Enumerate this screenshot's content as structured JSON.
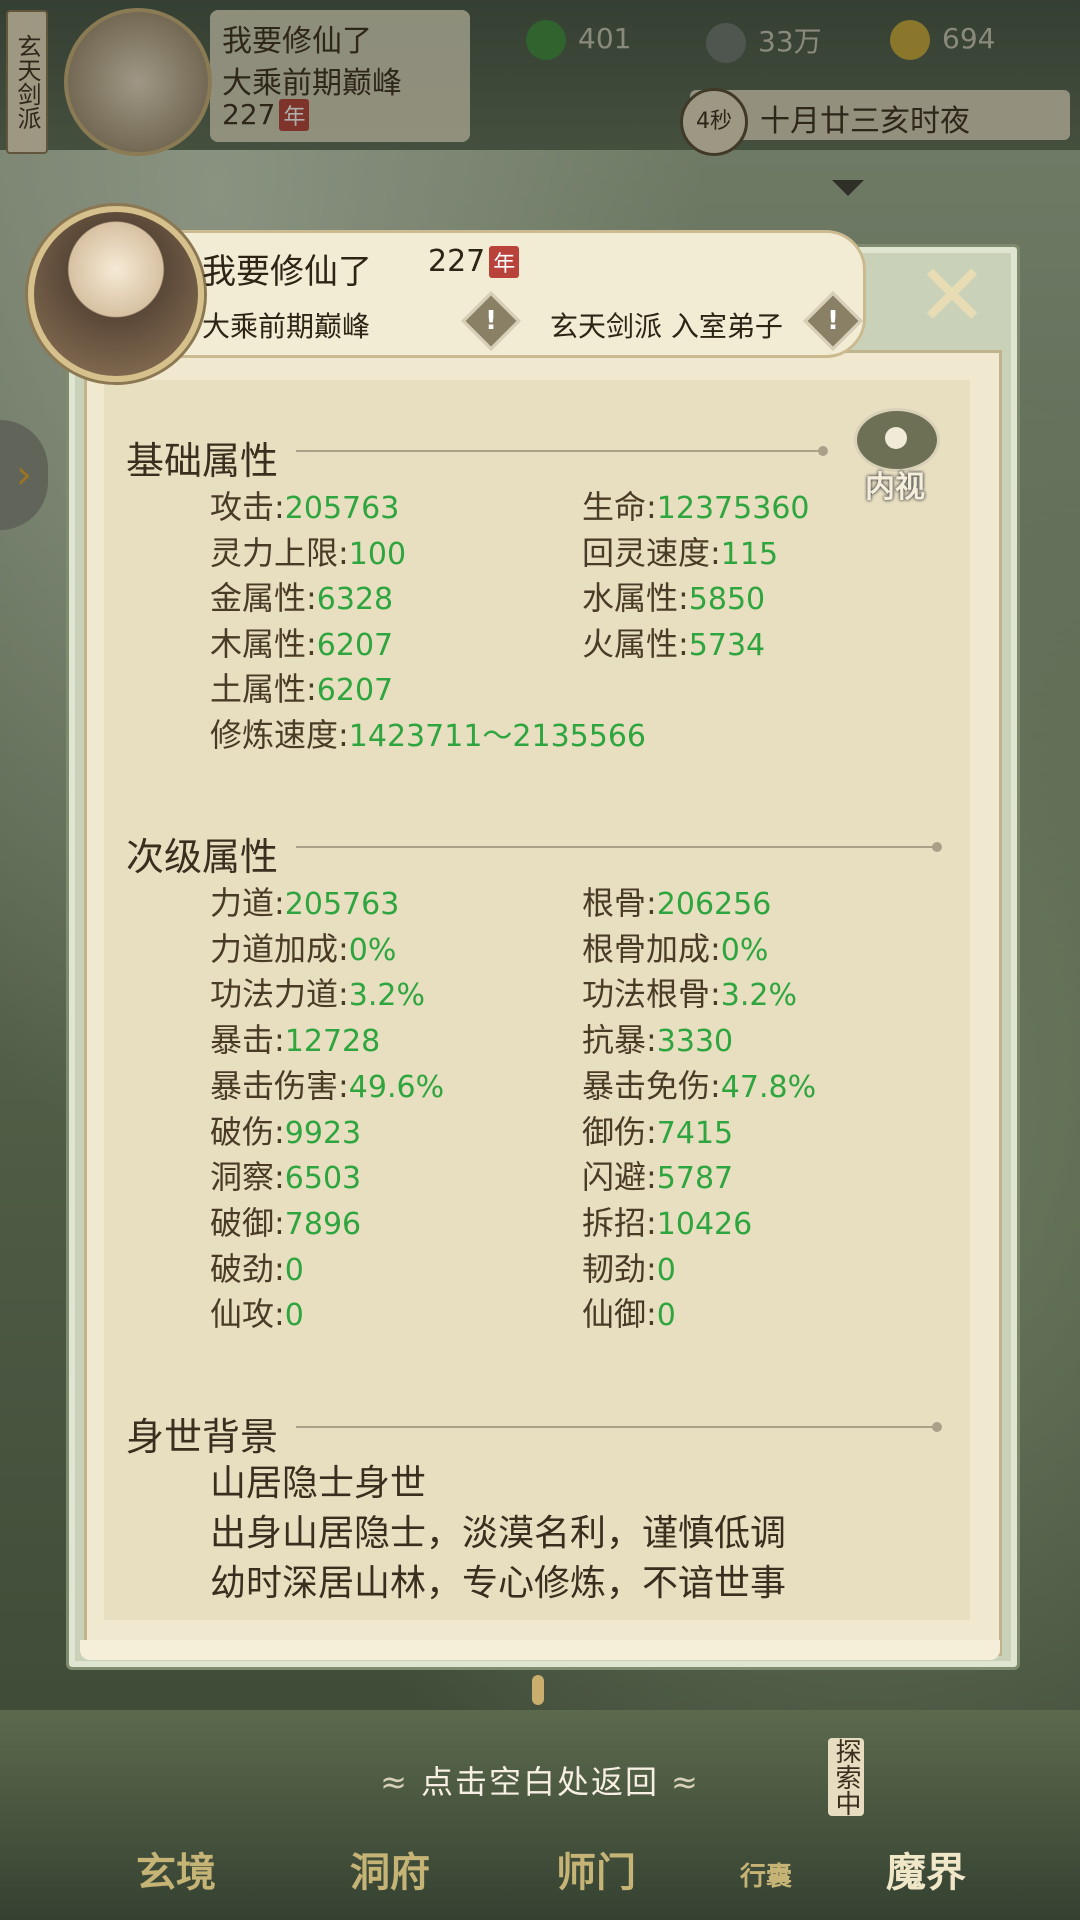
{
  "hud": {
    "sect_banner": "玄天剑派",
    "player_name": "我要修仙了",
    "realm": "大乘前期巅峰",
    "age": "227",
    "year_tag": "年",
    "resources": [
      {
        "icon": "leaf-icon",
        "value": "401"
      },
      {
        "icon": "coin-icon",
        "value": "33万"
      },
      {
        "icon": "ingot-icon",
        "value": "694"
      }
    ],
    "timer": "4秒",
    "date": "十月廿三亥时夜"
  },
  "panel": {
    "name": "我要修仙了",
    "age": "227",
    "year_tag": "年",
    "realm": "大乘前期巅峰",
    "sect": "玄天剑派 入室弟子",
    "inner_view_label": "内视",
    "basic_title": "基础属性",
    "basic_stats": [
      {
        "label": "攻击",
        "value": "205763"
      },
      {
        "label": "生命",
        "value": "12375360"
      },
      {
        "label": "灵力上限",
        "value": "100"
      },
      {
        "label": "回灵速度",
        "value": "115"
      },
      {
        "label": "金属性",
        "value": "6328"
      },
      {
        "label": "水属性",
        "value": "5850"
      },
      {
        "label": "木属性",
        "value": "6207"
      },
      {
        "label": "火属性",
        "value": "5734"
      },
      {
        "label": "土属性",
        "value": "6207"
      },
      {
        "label": "修炼速度",
        "value": "1423711～2135566"
      }
    ],
    "secondary_title": "次级属性",
    "secondary_stats": [
      {
        "label": "力道",
        "value": "205763"
      },
      {
        "label": "根骨",
        "value": "206256"
      },
      {
        "label": "力道加成",
        "value": "0%"
      },
      {
        "label": "根骨加成",
        "value": "0%"
      },
      {
        "label": "功法力道",
        "value": "3.2%"
      },
      {
        "label": "功法根骨",
        "value": "3.2%"
      },
      {
        "label": "暴击",
        "value": "12728"
      },
      {
        "label": "抗暴",
        "value": "3330"
      },
      {
        "label": "暴击伤害",
        "value": "49.6%"
      },
      {
        "label": "暴击免伤",
        "value": "47.8%"
      },
      {
        "label": "破伤",
        "value": "9923"
      },
      {
        "label": "御伤",
        "value": "7415"
      },
      {
        "label": "洞察",
        "value": "6503"
      },
      {
        "label": "闪避",
        "value": "5787"
      },
      {
        "label": "破御",
        "value": "7896"
      },
      {
        "label": "拆招",
        "value": "10426"
      },
      {
        "label": "破劲",
        "value": "0"
      },
      {
        "label": "韧劲",
        "value": "0"
      },
      {
        "label": "仙攻",
        "value": "0"
      },
      {
        "label": "仙御",
        "value": "0"
      }
    ],
    "background_title": "身世背景",
    "background_lines": [
      "山居隐士身世",
      "出身山居隐士，淡漠名利，谨慎低调",
      "幼时深居山林，专心修炼，不谙世事"
    ]
  },
  "return_hint": "点击空白处返回",
  "bottom_nav": [
    "玄境",
    "洞府",
    "师门",
    "行囊",
    "魔界"
  ],
  "exploring_label": "探索中",
  "colors": {
    "stat_value": "#2fa53f",
    "year_tag": "#b9423a"
  }
}
